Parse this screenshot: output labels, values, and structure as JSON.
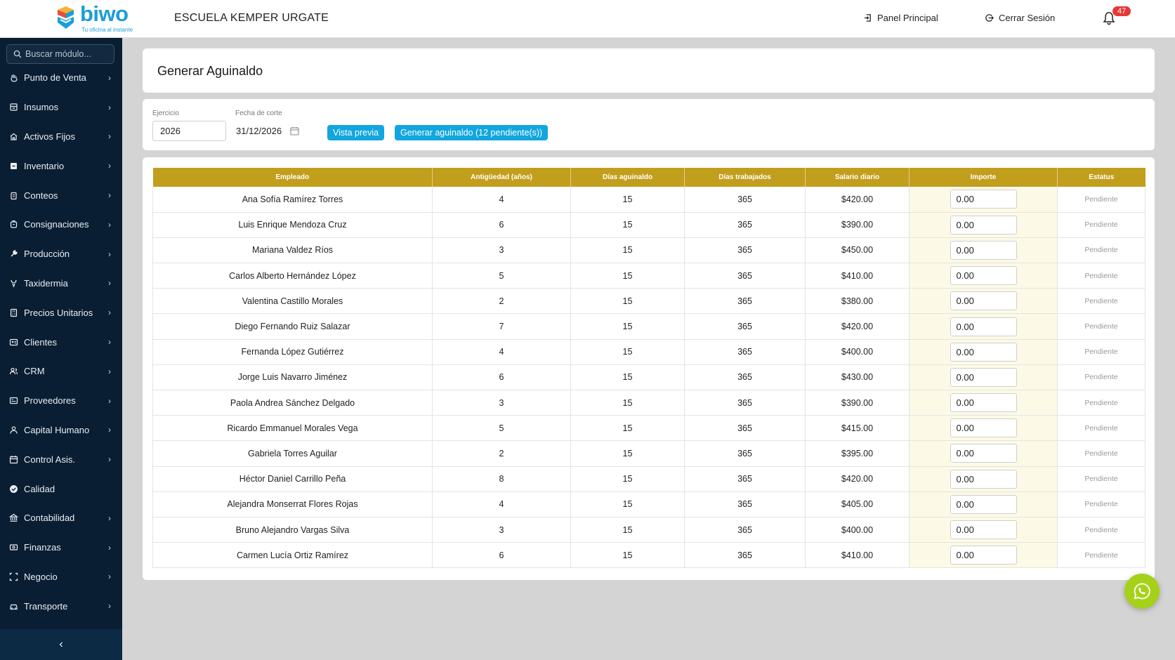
{
  "header": {
    "logo_text": "biwo",
    "logo_tagline": "Tu oficina al instante",
    "company": "ESCUELA KEMPER URGATE",
    "panel_label": "Panel Principal",
    "logout_label": "Cerrar Sesión",
    "notifications_count": "47"
  },
  "sidebar": {
    "search_placeholder": "Buscar módulo...",
    "items": [
      {
        "label": "Punto de Venta",
        "icon": "hand-icon",
        "chevron": true
      },
      {
        "label": "Insumos",
        "icon": "box-icon",
        "chevron": true
      },
      {
        "label": "Activos Fijos",
        "icon": "building-icon",
        "chevron": true
      },
      {
        "label": "Inventario",
        "icon": "inventory-icon",
        "chevron": true
      },
      {
        "label": "Conteos",
        "icon": "clipboard-icon",
        "chevron": true
      },
      {
        "label": "Consignaciones",
        "icon": "package-icon",
        "chevron": true
      },
      {
        "label": "Producción",
        "icon": "wrench-icon",
        "chevron": true
      },
      {
        "label": "Taxidermia",
        "icon": "deer-icon",
        "chevron": true
      },
      {
        "label": "Precios Unitarios",
        "icon": "calculator-icon",
        "chevron": true
      },
      {
        "label": "Clientes",
        "icon": "id-card-icon",
        "chevron": true
      },
      {
        "label": "CRM",
        "icon": "users-icon",
        "chevron": true
      },
      {
        "label": "Proveedores",
        "icon": "truck-list-icon",
        "chevron": true
      },
      {
        "label": "Capital Humano",
        "icon": "person-icon",
        "chevron": true
      },
      {
        "label": "Control Asis.",
        "icon": "calendar-icon",
        "chevron": true
      },
      {
        "label": "Calidad",
        "icon": "check-circle-icon",
        "chevron": false
      },
      {
        "label": "Contabilidad",
        "icon": "bank-icon",
        "chevron": true
      },
      {
        "label": "Finanzas",
        "icon": "money-icon",
        "chevron": true
      },
      {
        "label": "Negocio",
        "icon": "focus-icon",
        "chevron": true
      },
      {
        "label": "Transporte",
        "icon": "car-icon",
        "chevron": true
      }
    ],
    "collapse_label": "‹"
  },
  "page": {
    "title": "Generar Aguinaldo"
  },
  "filters": {
    "ejercicio_label": "Ejercicio",
    "ejercicio_value": "2026",
    "fecha_label": "Fecha de corte",
    "fecha_value": "31/12/2026",
    "preview_button": "Vista previa",
    "generate_button": "Generar aguinaldo (12 pendiente(s))"
  },
  "table": {
    "columns": [
      "Empleado",
      "Antigüedad (años)",
      "Días aguinaldo",
      "Días trabajados",
      "Salario diario",
      "Importe",
      "Estatus"
    ],
    "rows": [
      {
        "empleado": "Ana Sofía Ramírez Torres",
        "antiguedad": "4",
        "dias_aguinaldo": "15",
        "dias_trabajados": "365",
        "salario": "$420.00",
        "importe": "0.00",
        "estatus": "Pendiente"
      },
      {
        "empleado": "Luis Enrique Mendoza Cruz",
        "antiguedad": "6",
        "dias_aguinaldo": "15",
        "dias_trabajados": "365",
        "salario": "$390.00",
        "importe": "0.00",
        "estatus": "Pendiente"
      },
      {
        "empleado": "Mariana Valdez Ríos",
        "antiguedad": "3",
        "dias_aguinaldo": "15",
        "dias_trabajados": "365",
        "salario": "$450.00",
        "importe": "0.00",
        "estatus": "Pendiente"
      },
      {
        "empleado": "Carlos Alberto Hernández López",
        "antiguedad": "5",
        "dias_aguinaldo": "15",
        "dias_trabajados": "365",
        "salario": "$410.00",
        "importe": "0.00",
        "estatus": "Pendiente"
      },
      {
        "empleado": "Valentina Castillo Morales",
        "antiguedad": "2",
        "dias_aguinaldo": "15",
        "dias_trabajados": "365",
        "salario": "$380.00",
        "importe": "0.00",
        "estatus": "Pendiente"
      },
      {
        "empleado": "Diego Fernando Ruiz Salazar",
        "antiguedad": "7",
        "dias_aguinaldo": "15",
        "dias_trabajados": "365",
        "salario": "$420.00",
        "importe": "0.00",
        "estatus": "Pendiente"
      },
      {
        "empleado": "Fernanda López Gutiérrez",
        "antiguedad": "4",
        "dias_aguinaldo": "15",
        "dias_trabajados": "365",
        "salario": "$400.00",
        "importe": "0.00",
        "estatus": "Pendiente"
      },
      {
        "empleado": "Jorge Luis Navarro Jiménez",
        "antiguedad": "6",
        "dias_aguinaldo": "15",
        "dias_trabajados": "365",
        "salario": "$430.00",
        "importe": "0.00",
        "estatus": "Pendiente"
      },
      {
        "empleado": "Paola Andrea Sánchez Delgado",
        "antiguedad": "3",
        "dias_aguinaldo": "15",
        "dias_trabajados": "365",
        "salario": "$390.00",
        "importe": "0.00",
        "estatus": "Pendiente"
      },
      {
        "empleado": "Ricardo Emmanuel Morales Vega",
        "antiguedad": "5",
        "dias_aguinaldo": "15",
        "dias_trabajados": "365",
        "salario": "$415.00",
        "importe": "0.00",
        "estatus": "Pendiente"
      },
      {
        "empleado": "Gabriela Torres Aguilar",
        "antiguedad": "2",
        "dias_aguinaldo": "15",
        "dias_trabajados": "365",
        "salario": "$395.00",
        "importe": "0.00",
        "estatus": "Pendiente"
      },
      {
        "empleado": "Héctor Daniel Carrillo Peña",
        "antiguedad": "8",
        "dias_aguinaldo": "15",
        "dias_trabajados": "365",
        "salario": "$420.00",
        "importe": "0.00",
        "estatus": "Pendiente"
      },
      {
        "empleado": "Alejandra Monserrat Flores Rojas",
        "antiguedad": "4",
        "dias_aguinaldo": "15",
        "dias_trabajados": "365",
        "salario": "$405.00",
        "importe": "0.00",
        "estatus": "Pendiente"
      },
      {
        "empleado": "Bruno Alejandro Vargas Silva",
        "antiguedad": "3",
        "dias_aguinaldo": "15",
        "dias_trabajados": "365",
        "salario": "$400.00",
        "importe": "0.00",
        "estatus": "Pendiente"
      },
      {
        "empleado": "Carmen Lucía Ortiz Ramírez",
        "antiguedad": "6",
        "dias_aguinaldo": "15",
        "dias_trabajados": "365",
        "salario": "$410.00",
        "importe": "0.00",
        "estatus": "Pendiente"
      }
    ]
  },
  "colors": {
    "sidebar_bg": "#0a1e33",
    "header_row": "#c29e1d",
    "primary_button": "#12a6de",
    "importe_cell": "#fcfae6",
    "whatsapp": "#a6d11a",
    "badge": "#e53935"
  }
}
